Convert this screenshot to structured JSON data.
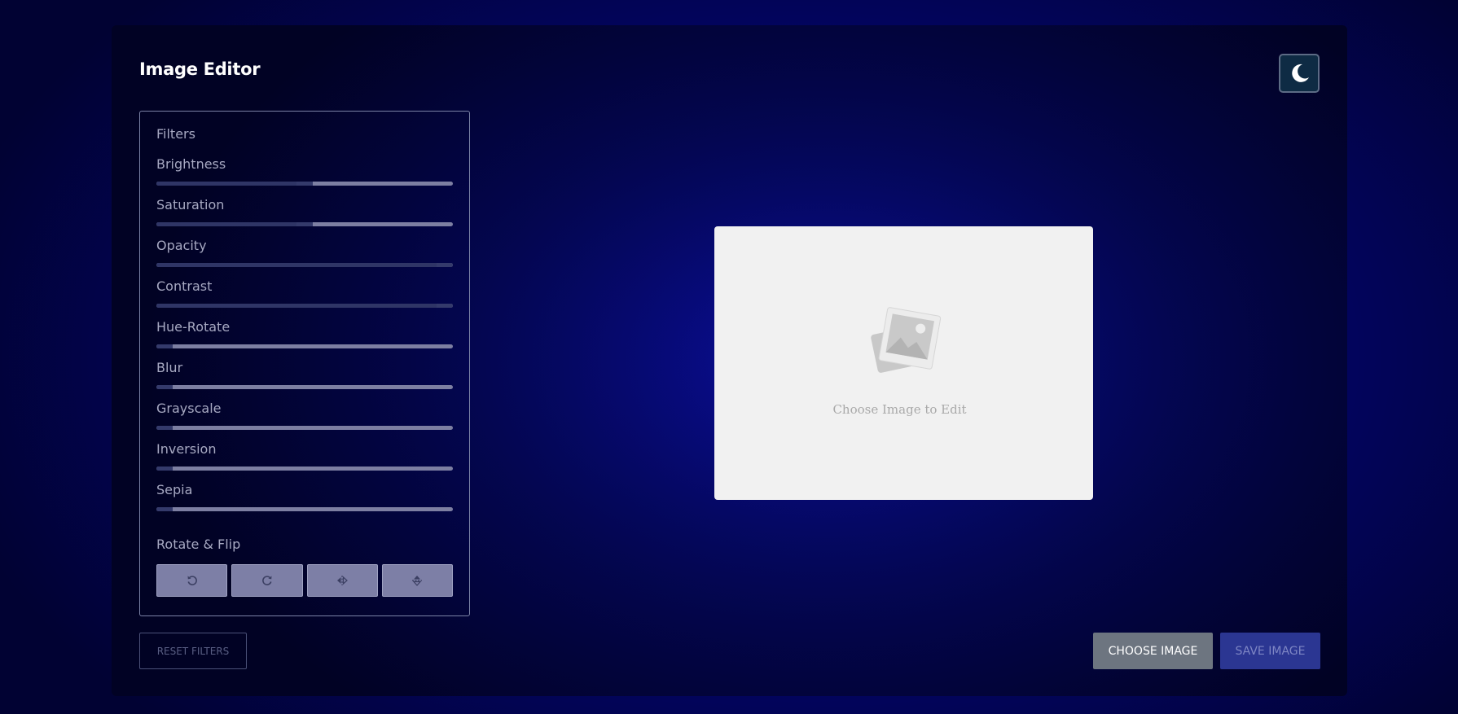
{
  "app": {
    "title": "Image Editor"
  },
  "theme_toggle": {
    "icon": "moon-icon"
  },
  "filters": {
    "title": "Filters",
    "items": [
      {
        "label": "Brightness",
        "value": 0.5
      },
      {
        "label": "Saturation",
        "value": 0.5
      },
      {
        "label": "Opacity",
        "value": 1.0
      },
      {
        "label": "Contrast",
        "value": 1.0
      },
      {
        "label": "Hue-Rotate",
        "value": 0.0
      },
      {
        "label": "Blur",
        "value": 0.0
      },
      {
        "label": "Grayscale",
        "value": 0.0
      },
      {
        "label": "Inversion",
        "value": 0.0
      },
      {
        "label": "Sepia",
        "value": 0.0
      }
    ]
  },
  "rotate_flip": {
    "title": "Rotate & Flip",
    "buttons": [
      {
        "name": "rotate-left",
        "icon": "rotate-left-icon"
      },
      {
        "name": "rotate-right",
        "icon": "rotate-right-icon"
      },
      {
        "name": "flip-horizontal",
        "icon": "flip-horizontal-icon"
      },
      {
        "name": "flip-vertical",
        "icon": "flip-vertical-icon"
      }
    ]
  },
  "buttons": {
    "reset": "RESET FILTERS",
    "choose": "CHOOSE IMAGE",
    "save": "SAVE IMAGE"
  },
  "preview": {
    "placeholder": "Choose Image to Edit",
    "icon": "image-placeholder-icon"
  },
  "colors": {
    "accent": "#2b3692",
    "muted_button": "#6d7580",
    "panel_border": "#7b83a6"
  }
}
